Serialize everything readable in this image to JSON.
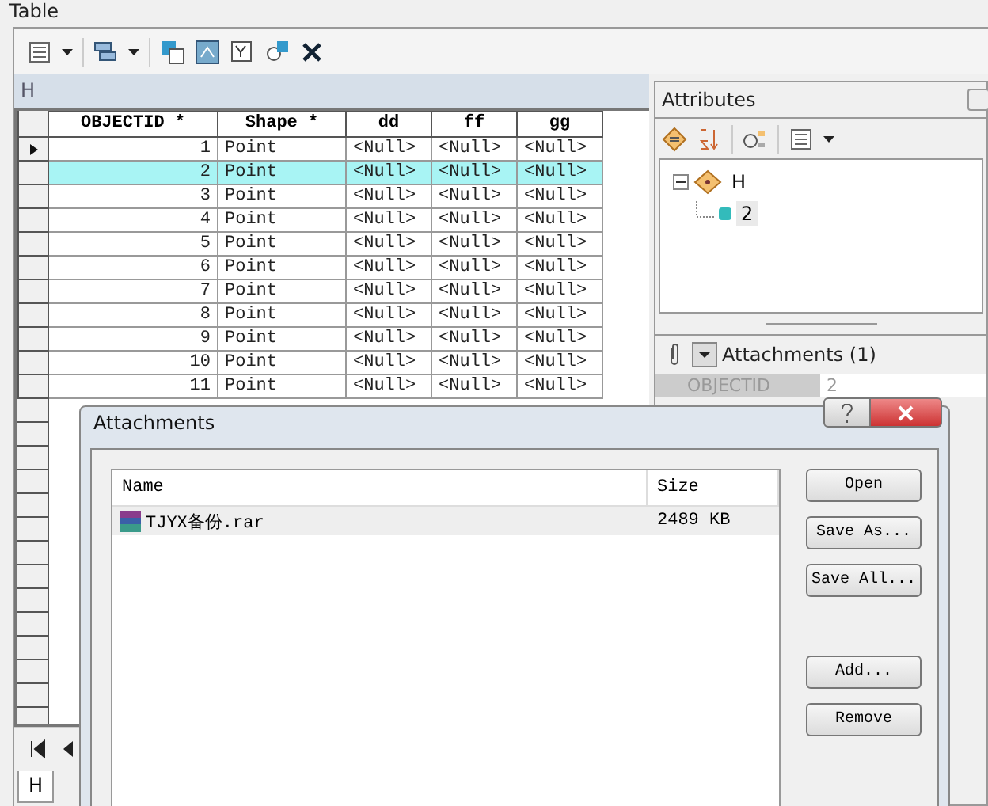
{
  "window": {
    "title": "Table"
  },
  "table": {
    "name": "H",
    "columns": [
      "OBJECTID *",
      "Shape *",
      "dd",
      "ff",
      "gg"
    ],
    "rows": [
      {
        "cells": [
          "1",
          "Point",
          "<Null>",
          "<Null>",
          "<Null>"
        ],
        "current": true,
        "selected": false
      },
      {
        "cells": [
          "2",
          "Point",
          "<Null>",
          "<Null>",
          "<Null>"
        ],
        "current": false,
        "selected": true
      },
      {
        "cells": [
          "3",
          "Point",
          "<Null>",
          "<Null>",
          "<Null>"
        ],
        "current": false,
        "selected": false
      },
      {
        "cells": [
          "4",
          "Point",
          "<Null>",
          "<Null>",
          "<Null>"
        ],
        "current": false,
        "selected": false
      },
      {
        "cells": [
          "5",
          "Point",
          "<Null>",
          "<Null>",
          "<Null>"
        ],
        "current": false,
        "selected": false
      },
      {
        "cells": [
          "6",
          "Point",
          "<Null>",
          "<Null>",
          "<Null>"
        ],
        "current": false,
        "selected": false
      },
      {
        "cells": [
          "7",
          "Point",
          "<Null>",
          "<Null>",
          "<Null>"
        ],
        "current": false,
        "selected": false
      },
      {
        "cells": [
          "8",
          "Point",
          "<Null>",
          "<Null>",
          "<Null>"
        ],
        "current": false,
        "selected": false
      },
      {
        "cells": [
          "9",
          "Point",
          "<Null>",
          "<Null>",
          "<Null>"
        ],
        "current": false,
        "selected": false
      },
      {
        "cells": [
          "10",
          "Point",
          "<Null>",
          "<Null>",
          "<Null>"
        ],
        "current": false,
        "selected": false
      },
      {
        "cells": [
          "11",
          "Point",
          "<Null>",
          "<Null>",
          "<Null>"
        ],
        "current": false,
        "selected": false
      }
    ]
  },
  "tabs": [
    {
      "label": "H",
      "selected": true
    }
  ],
  "attributes": {
    "title": "Attributes",
    "tree": [
      {
        "label": "H",
        "expanded": true,
        "children": [
          {
            "label": "2"
          }
        ]
      }
    ],
    "attachments_label": "Attachments (1)",
    "field_row": [
      "OBJECTID",
      "2"
    ]
  },
  "dialog": {
    "title": "Attachments",
    "columns": [
      "Name",
      "Size"
    ],
    "files": [
      {
        "name": "TJYX备份.rar",
        "size": "2489 KB",
        "selected": true
      }
    ],
    "file_buttons": [
      "Open",
      "Save As...",
      "Save All..."
    ],
    "edit_buttons": [
      "Add...",
      "Remove"
    ]
  }
}
